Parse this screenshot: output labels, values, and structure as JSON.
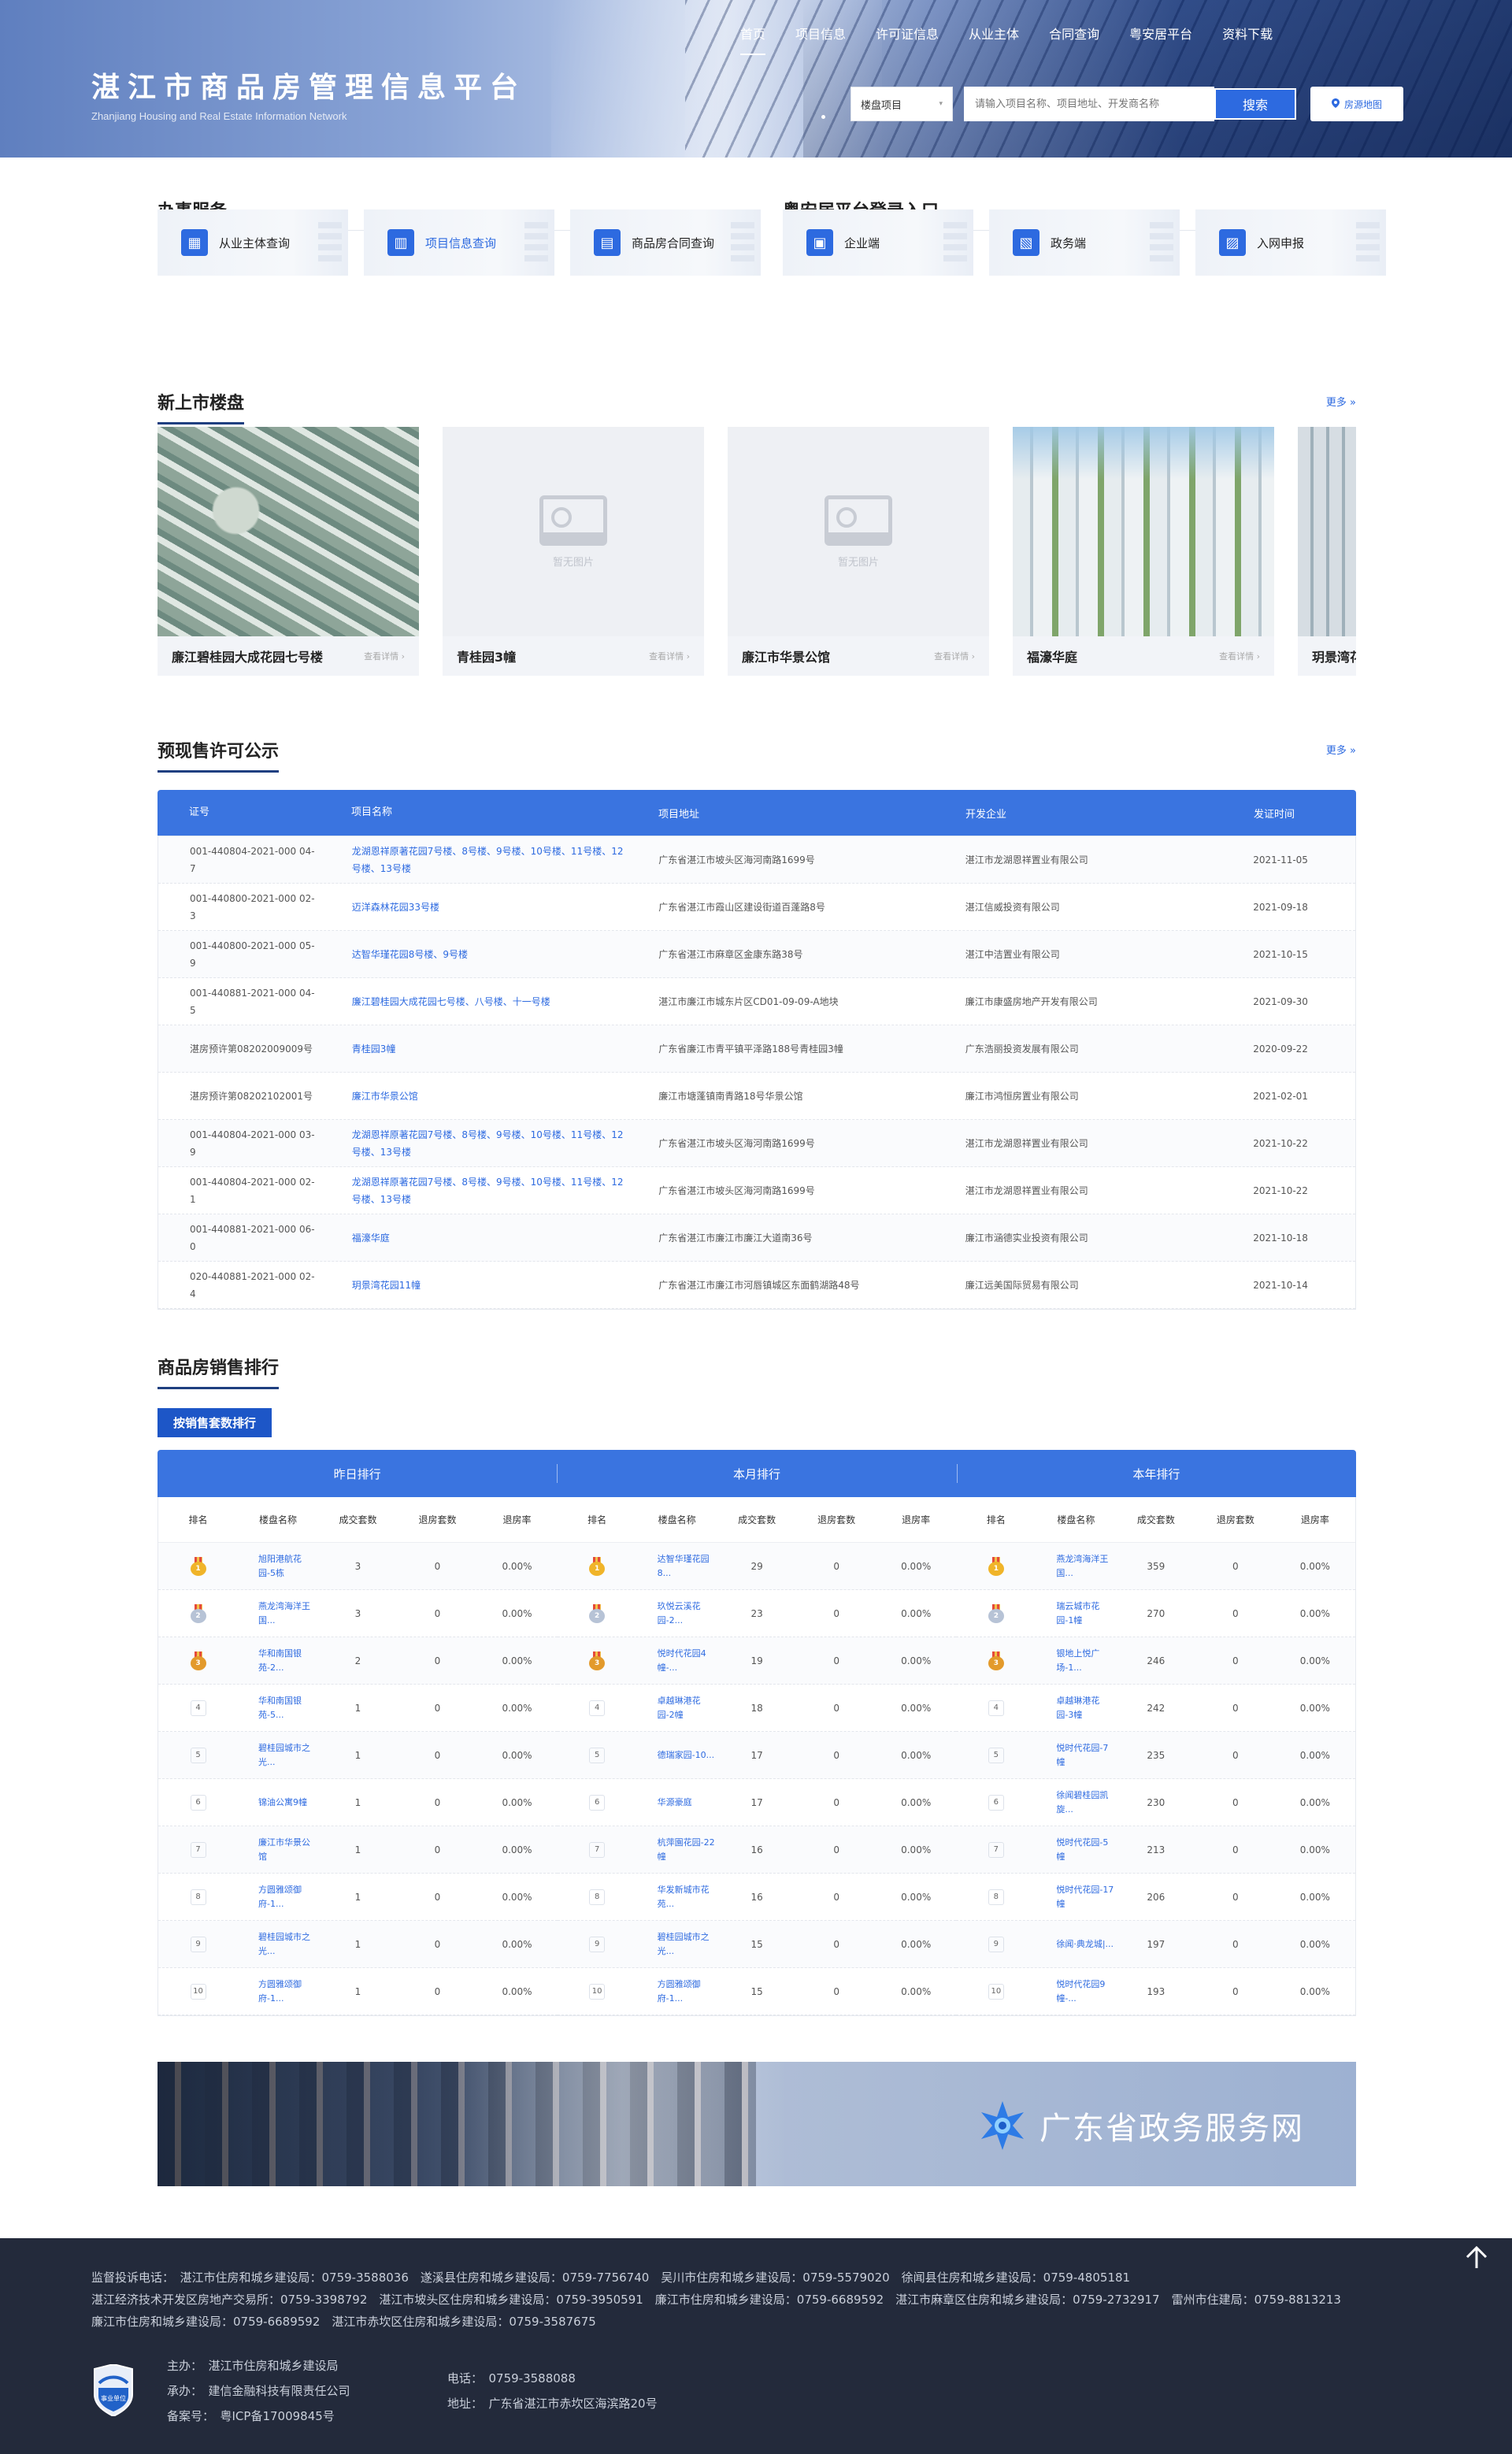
{
  "header": {
    "title": "湛江市商品房管理信息平台",
    "subtitle": "Zhanjiang Housing and Real Estate Information Network",
    "nav": [
      "首页",
      "项目信息",
      "许可证信息",
      "从业主体",
      "合同查询",
      "粤安居平台",
      "资料下载"
    ],
    "select_value": "楼盘项目",
    "search_placeholder": "请输入项目名称、项目地址、开发商名称",
    "search_button": "搜索",
    "map_button": "房源地图"
  },
  "services": {
    "title": "办事服务",
    "items": [
      {
        "label": "从业主体查询",
        "icon": "building-icon"
      },
      {
        "label": "项目信息查询",
        "icon": "chart-icon"
      },
      {
        "label": "商品房合同查询",
        "icon": "document-icon"
      }
    ]
  },
  "login": {
    "title": "粤安居平台登录入口",
    "items": [
      {
        "label": "企业端",
        "icon": "office-icon"
      },
      {
        "label": "政务端",
        "icon": "govt-icon"
      },
      {
        "label": "入网申报",
        "icon": "report-icon"
      }
    ]
  },
  "new_listings": {
    "title": "新上市楼盘",
    "more": "更多 »",
    "detail_label": "查看详情 ›",
    "no_image": "暂无图片",
    "items": [
      {
        "name": "廉江碧桂园大成花园七号楼",
        "image": "photo"
      },
      {
        "name": "青桂园3幢",
        "image": "none"
      },
      {
        "name": "廉江市华景公馆",
        "image": "none"
      },
      {
        "name": "福濠华庭",
        "image": "photo"
      },
      {
        "name": "玥景湾花园",
        "image": "photo"
      }
    ]
  },
  "permits": {
    "title": "预现售许可公示",
    "more": "更多 »",
    "columns": [
      "证号",
      "项目名称",
      "项目地址",
      "开发企业",
      "发证时间"
    ],
    "rows": [
      [
        "001-440804-2021-000 04-7",
        "龙湖恩祥原著花园7号楼、8号楼、9号楼、10号楼、11号楼、12号楼、13号楼",
        "广东省湛江市坡头区海河南路1699号",
        "湛江市龙湖恩祥置业有限公司",
        "2021-11-05"
      ],
      [
        "001-440800-2021-000 02-3",
        "迈洋森林花园33号楼",
        "广东省湛江市霞山区建设街道百蓬路8号",
        "湛江信威投资有限公司",
        "2021-09-18"
      ],
      [
        "001-440800-2021-000 05-9",
        "达智华瑾花园8号楼、9号楼",
        "广东省湛江市麻章区金康东路38号",
        "湛江中洁置业有限公司",
        "2021-10-15"
      ],
      [
        "001-440881-2021-000 04-5",
        "廉江碧桂园大成花园七号楼、八号楼、十一号楼",
        "湛江市廉江市城东片区CD01-09-09-A地块",
        "廉江市康盛房地产开发有限公司",
        "2021-09-30"
      ],
      [
        "湛房预许第08202009009号",
        "青桂园3幢",
        "广东省廉江市青平镇平泽路188号青桂园3幢",
        "广东浩丽投资发展有限公司",
        "2020-09-22"
      ],
      [
        "湛房预许第08202102001号",
        "廉江市华景公馆",
        "廉江市塘蓬镇南青路18号华景公馆",
        "廉江市鸿恒房置业有限公司",
        "2021-02-01"
      ],
      [
        "001-440804-2021-000 03-9",
        "龙湖恩祥原著花园7号楼、8号楼、9号楼、10号楼、11号楼、12号楼、13号楼",
        "广东省湛江市坡头区海河南路1699号",
        "湛江市龙湖恩祥置业有限公司",
        "2021-10-22"
      ],
      [
        "001-440804-2021-000 02-1",
        "龙湖恩祥原著花园7号楼、8号楼、9号楼、10号楼、11号楼、12号楼、13号楼",
        "广东省湛江市坡头区海河南路1699号",
        "湛江市龙湖恩祥置业有限公司",
        "2021-10-22"
      ],
      [
        "001-440881-2021-000 06-0",
        "福濠华庭",
        "广东省湛江市廉江市廉江大道南36号",
        "廉江市涵德实业投资有限公司",
        "2021-10-18"
      ],
      [
        "020-440881-2021-000 02-4",
        "玥景湾花园11幢",
        "广东省湛江市廉江市河唇镇城区东面鹤湖路48号",
        "廉江远美国际贸易有限公司",
        "2021-10-14"
      ]
    ]
  },
  "ranking": {
    "title": "商品房销售排行",
    "tab": "按销售套数排行",
    "periods": [
      "昨日排行",
      "本月排行",
      "本年排行"
    ],
    "columns": [
      "排名",
      "楼盘名称",
      "成交套数",
      "退房套数",
      "退房率"
    ],
    "daily": [
      [
        "1",
        "旭阳港航花园-5栋",
        "3",
        "0",
        "0.00%"
      ],
      [
        "2",
        "燕龙湾海洋王国...",
        "3",
        "0",
        "0.00%"
      ],
      [
        "3",
        "华和南国银苑-2...",
        "2",
        "0",
        "0.00%"
      ],
      [
        "4",
        "华和南国银苑-5...",
        "1",
        "0",
        "0.00%"
      ],
      [
        "5",
        "碧桂园城市之光...",
        "1",
        "0",
        "0.00%"
      ],
      [
        "6",
        "锦油公寓9幢",
        "1",
        "0",
        "0.00%"
      ],
      [
        "7",
        "廉江市华景公馆",
        "1",
        "0",
        "0.00%"
      ],
      [
        "8",
        "方圆雅颂御府-1...",
        "1",
        "0",
        "0.00%"
      ],
      [
        "9",
        "碧桂园城市之光...",
        "1",
        "0",
        "0.00%"
      ],
      [
        "10",
        "方圆雅颂御府-1...",
        "1",
        "0",
        "0.00%"
      ]
    ],
    "monthly": [
      [
        "1",
        "达智华瑾花园8...",
        "29",
        "0",
        "0.00%"
      ],
      [
        "2",
        "玖悦云溪花园-2...",
        "23",
        "0",
        "0.00%"
      ],
      [
        "3",
        "悦时代花园4幢-...",
        "19",
        "0",
        "0.00%"
      ],
      [
        "4",
        "卓越琳港花园-2幢",
        "18",
        "0",
        "0.00%"
      ],
      [
        "5",
        "德瑞家园-10...",
        "17",
        "0",
        "0.00%"
      ],
      [
        "6",
        "华源豪庭",
        "17",
        "0",
        "0.00%"
      ],
      [
        "7",
        "杭萍園花园-22幢",
        "16",
        "0",
        "0.00%"
      ],
      [
        "8",
        "华发新城市花苑...",
        "16",
        "0",
        "0.00%"
      ],
      [
        "9",
        "碧桂园城市之光...",
        "15",
        "0",
        "0.00%"
      ],
      [
        "10",
        "方圆雅颂御府-1...",
        "15",
        "0",
        "0.00%"
      ]
    ],
    "yearly": [
      [
        "1",
        "燕龙湾海洋王国...",
        "359",
        "0",
        "0.00%"
      ],
      [
        "2",
        "瑞云城市花园-1幢",
        "270",
        "0",
        "0.00%"
      ],
      [
        "3",
        "银地上悦广场-1...",
        "246",
        "0",
        "0.00%"
      ],
      [
        "4",
        "卓越琳港花园-3幢",
        "242",
        "0",
        "0.00%"
      ],
      [
        "5",
        "悦时代花园-7幢",
        "235",
        "0",
        "0.00%"
      ],
      [
        "6",
        "徐闻碧桂园凯旋...",
        "230",
        "0",
        "0.00%"
      ],
      [
        "7",
        "悦时代花园-5幢",
        "213",
        "0",
        "0.00%"
      ],
      [
        "8",
        "悦时代花园-17幢",
        "206",
        "0",
        "0.00%"
      ],
      [
        "9",
        "徐闻·典龙城|...",
        "197",
        "0",
        "0.00%"
      ],
      [
        "10",
        "悦时代花园9幢-...",
        "193",
        "0",
        "0.00%"
      ]
    ]
  },
  "banner": {
    "text": "广东省政务服务网"
  },
  "footer": {
    "lines": [
      "监督投诉电话：　湛江市住房和城乡建设局：0759-3588036　遂溪县住房和城乡建设局：0759-7756740　吴川市住房和城乡建设局：0759-5579020　徐闻县住房和城乡建设局：0759-4805181",
      "湛江经济技术开发区房地产交易所：0759-3398792　湛江市坡头区住房和城乡建设局：0759-3950591　廉江市住房和城乡建设局：0759-6689592　湛江市麻章区住房和城乡建设局：0759-2732917　雷州市住建局：0759-8813213",
      "廉江市住房和城乡建设局：0759-6689592　湛江市赤坎区住房和城乡建设局：0759-3587675"
    ],
    "host": "主办：　湛江市住房和城乡建设局",
    "support": "承办：　建信金融科技有限责任公司",
    "icp": "备案号：　粤ICP备17009845号",
    "phone": "电话：　0759-3588088",
    "address": "地址：　广东省湛江市赤坎区海滨路20号",
    "badge_text": "事业单位"
  },
  "colors": {
    "primary": "#3a74e0",
    "header_dark": "#1f3f80",
    "footer_bg": "#232a3b"
  }
}
